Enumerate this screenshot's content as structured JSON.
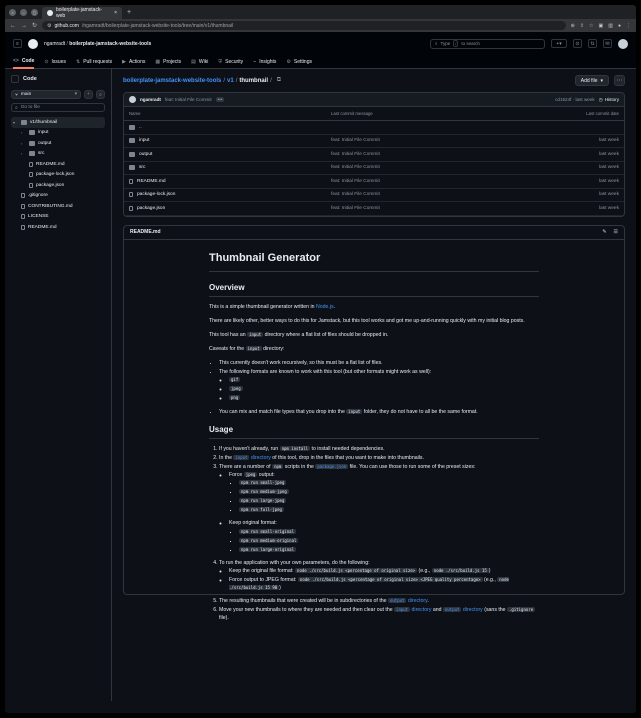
{
  "browser": {
    "tab_title": "boilerplate-jamstack-web",
    "url_host": "github.com",
    "url_path": "/ngamradt/boilerplate-jamstack-website-tools/tree/main/v1/thumbnail"
  },
  "header": {
    "owner": "ngamradt",
    "repo": "boilerplate-jamstack-website-tools",
    "search_pre": "Type",
    "search_key": "/",
    "search_post": "to search"
  },
  "nav": [
    {
      "icon": "<>",
      "label": "Code"
    },
    {
      "icon": "⊙",
      "label": "Issues"
    },
    {
      "icon": "⇅",
      "label": "Pull requests"
    },
    {
      "icon": "▶",
      "label": "Actions"
    },
    {
      "icon": "▦",
      "label": "Projects"
    },
    {
      "icon": "▤",
      "label": "Wiki"
    },
    {
      "icon": "⛨",
      "label": "Security"
    },
    {
      "icon": "⌁",
      "label": "Insights"
    },
    {
      "icon": "⚙",
      "label": "Settings"
    }
  ],
  "sidebar": {
    "title": "Code",
    "branch": "main",
    "goto_placeholder": "Go to file",
    "tree": [
      {
        "label": "v1/thumbnail",
        "type": "folder",
        "indent": 0,
        "chev": "▾",
        "selected": true
      },
      {
        "label": "input",
        "type": "folder",
        "indent": 1,
        "chev": "›"
      },
      {
        "label": "output",
        "type": "folder",
        "indent": 1,
        "chev": "›"
      },
      {
        "label": "src",
        "type": "folder",
        "indent": 1,
        "chev": "›"
      },
      {
        "label": "README.md",
        "type": "file",
        "indent": 1,
        "chev": ""
      },
      {
        "label": "package-lock.json",
        "type": "file",
        "indent": 1,
        "chev": ""
      },
      {
        "label": "package.json",
        "type": "file",
        "indent": 1,
        "chev": ""
      },
      {
        "label": ".gitignore",
        "type": "file",
        "indent": 0,
        "chev": ""
      },
      {
        "label": "CONTRIBUTING.md",
        "type": "file",
        "indent": 0,
        "chev": ""
      },
      {
        "label": "LICENSE",
        "type": "file",
        "indent": 0,
        "chev": ""
      },
      {
        "label": "README.md",
        "type": "file",
        "indent": 0,
        "chev": ""
      }
    ]
  },
  "path": {
    "repo": "boilerplate-jamstack-website-tools",
    "seg1": "v1",
    "current": "thumbnail",
    "add_file": "Add file"
  },
  "commit": {
    "author": "ngamradt",
    "message": "feat: Initial File Commit",
    "dots": "•••",
    "sha": "cd1524f · last week",
    "history": "History"
  },
  "table": {
    "headers": [
      "Name",
      "Last commit message",
      "Last commit date"
    ],
    "rows": [
      {
        "name": "..",
        "type": "up",
        "msg": "",
        "date": ""
      },
      {
        "name": "input",
        "type": "folder",
        "msg": "feat: Initial File Commit",
        "date": "last week"
      },
      {
        "name": "output",
        "type": "folder",
        "msg": "feat: Initial File Commit",
        "date": "last week"
      },
      {
        "name": "src",
        "type": "folder",
        "msg": "feat: Initial File Commit",
        "date": "last week"
      },
      {
        "name": "README.md",
        "type": "file",
        "msg": "feat: Initial File Commit",
        "date": "last week"
      },
      {
        "name": "package-lock.json",
        "type": "file",
        "msg": "feat: Initial File Commit",
        "date": "last week"
      },
      {
        "name": "package.json",
        "type": "file",
        "msg": "feat: Initial File Commit",
        "date": "last week"
      }
    ]
  },
  "readme": {
    "label": "README.md",
    "h1": "Thumbnail Generator",
    "h2_overview": "Overview",
    "p1_pre": "This is a simple thumbnail generator written in ",
    "p1_link": "Node.js",
    "p1_post": ".",
    "p2": "There are likely other, better ways to do this for Jamstack, but this tool works and got me up-and-running quickly with my initial blog posts.",
    "p3_pre": "This tool has an ",
    "p3_code": "input",
    "p3_post": " directory where a flat list of files should be dropped in.",
    "p4_pre": "Caveats for the ",
    "p4_code": "input",
    "p4_post": " directory:",
    "cav1": "This currently doesn't work recursively, so this must be a flat list of files.",
    "cav2": "The following formats are known to work with this tool (but other formats might work as well):",
    "fmt": [
      "gif",
      "jpeg",
      "png"
    ],
    "cav3_pre": "You can mix and match file types that you drop into the ",
    "cav3_code": "input",
    "cav3_post": " folder, they do not have to all be the same format.",
    "h2_usage": "Usage",
    "u1_pre": "If you haven't already, run ",
    "u1_code": "npm install",
    "u1_post": " to install needed dependencies.",
    "u2_pre": "In the ",
    "u2_link_code": "input",
    "u2_link": " directory",
    "u2_post": " of this tool, drop in the files that you want to make into thumbnails.",
    "u3_pre": "There are a number of ",
    "u3_code": "npm",
    "u3_mid": " scripts in the ",
    "u3_code2": "package.json",
    "u3_post": " file. You can use those to run some of the preset sizes:",
    "force_pre": "Force ",
    "force_code": "jpeg",
    "force_post": " output:",
    "jpeg_cmds": [
      "npm run small-jpeg",
      "npm run medium-jpeg",
      "npm run large-jpeg",
      "npm run full-jpeg"
    ],
    "keep": "Keep original format:",
    "orig_cmds": [
      "npm run small-original",
      "npm run medium-original",
      "npm run large-original"
    ],
    "u4": "To run the application with your own parameters, do the following:",
    "k1_pre": "Keep the original file format: ",
    "k1_code": "node ./src/build.js <percentage of original size>",
    "k1_mid": " (e.g., ",
    "k1_code2": "node ./src/build.js 15",
    "k1_post": ")",
    "k2_pre": "Force output to JPEG format: ",
    "k2_code": "node ./src/build.js <percentage of original size> <JPEG quality percentage>",
    "k2_mid": " (e.g., ",
    "k2_code2": "node ./src/build.js 15 90",
    "k2_post": ")",
    "u5_pre": "The resulting thumbnails that were created will be in subdirectories of the ",
    "u5_code": "output",
    "u5_link": " directory",
    "u5_post": ".",
    "u6_pre": "Move your new thumbnails to where they are needed and then clear out the ",
    "u6_code": "input",
    "u6_link1": " directory",
    "u6_and": " and ",
    "u6_code2": "output",
    "u6_link2": " directory",
    "u6_mid": " (sans the ",
    "u6_code3": ".gitignore",
    "u6_post": " file)."
  }
}
